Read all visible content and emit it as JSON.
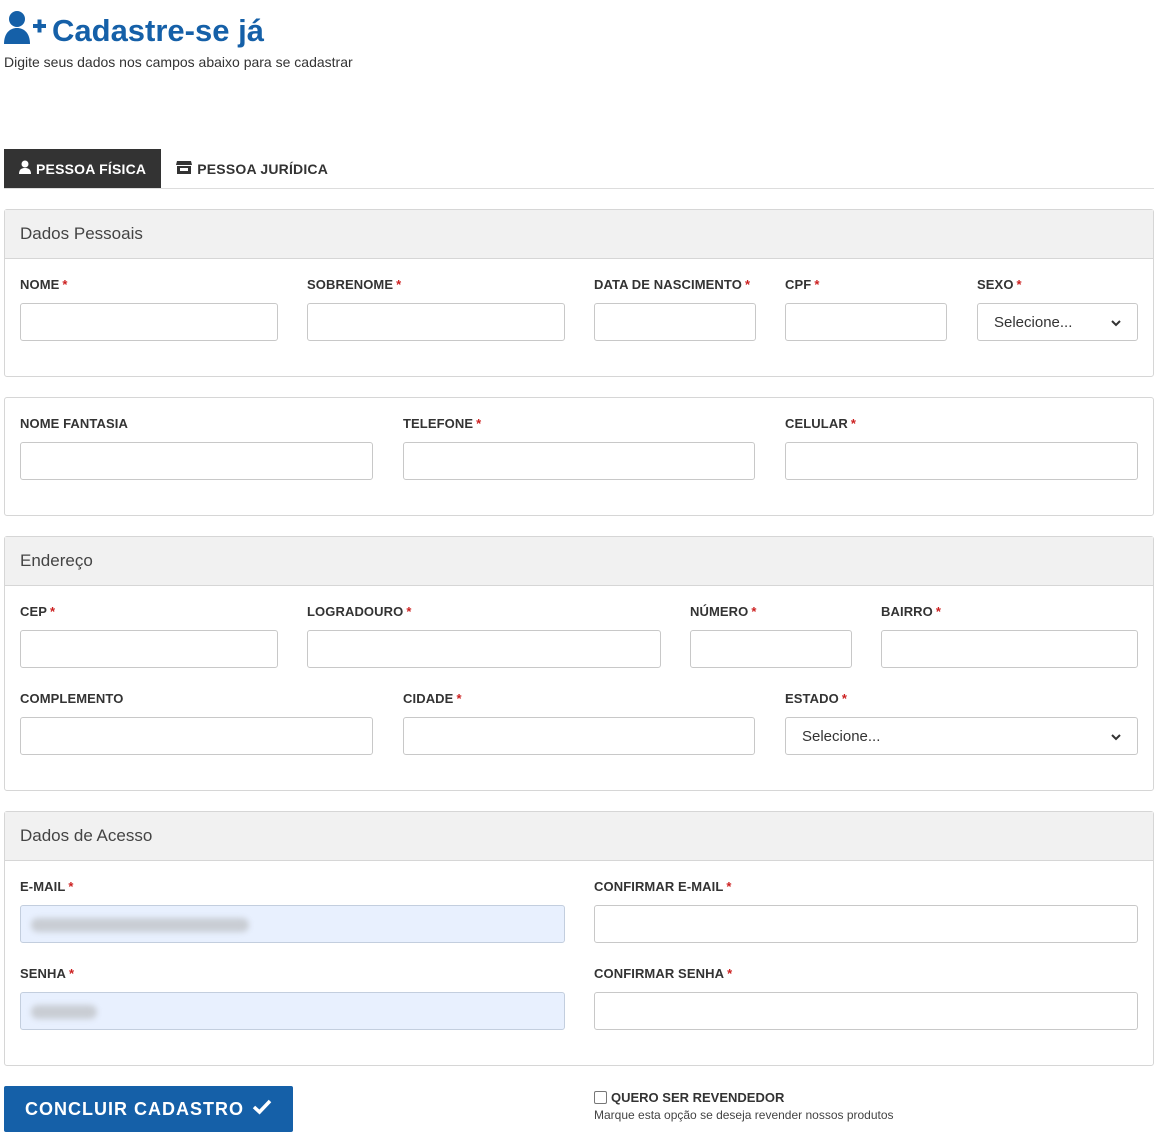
{
  "header": {
    "title": "Cadastre-se já",
    "subtitle": "Digite seus dados nos campos abaixo para se cadastrar"
  },
  "tabs": [
    {
      "label": "PESSOA FÍSICA",
      "active": true
    },
    {
      "label": "PESSOA JURÍDICA",
      "active": false
    }
  ],
  "personal": {
    "heading": "Dados Pessoais",
    "nome": "NOME",
    "sobrenome": "SOBRENOME",
    "nascimento": "DATA DE NASCIMENTO",
    "cpf": "CPF",
    "sexo": "SEXO",
    "sexo_value": "Selecione...",
    "nome_fantasia": "NOME FANTASIA",
    "telefone": "TELEFONE",
    "celular": "CELULAR"
  },
  "address": {
    "heading": "Endereço",
    "cep": "CEP",
    "logradouro": "LOGRADOURO",
    "numero": "NÚMERO",
    "bairro": "BAIRRO",
    "complemento": "COMPLEMENTO",
    "cidade": "CIDADE",
    "estado": "ESTADO",
    "estado_value": "Selecione..."
  },
  "access": {
    "heading": "Dados de Acesso",
    "email": "E-MAIL",
    "confirm_email": "CONFIRMAR E-MAIL",
    "senha": "SENHA",
    "confirm_senha": "CONFIRMAR SENHA"
  },
  "required_mark": "*",
  "submit_label": "CONCLUIR CADASTRO",
  "reseller": {
    "label": "QUERO SER REVENDEDOR",
    "help": "Marque esta opção se deseja revender nossos produtos",
    "checked": false
  },
  "colors": {
    "brand": "#1560a8",
    "active_tab": "#333333",
    "required": "#cc1f1f",
    "autofill": "#e8f0fe"
  }
}
